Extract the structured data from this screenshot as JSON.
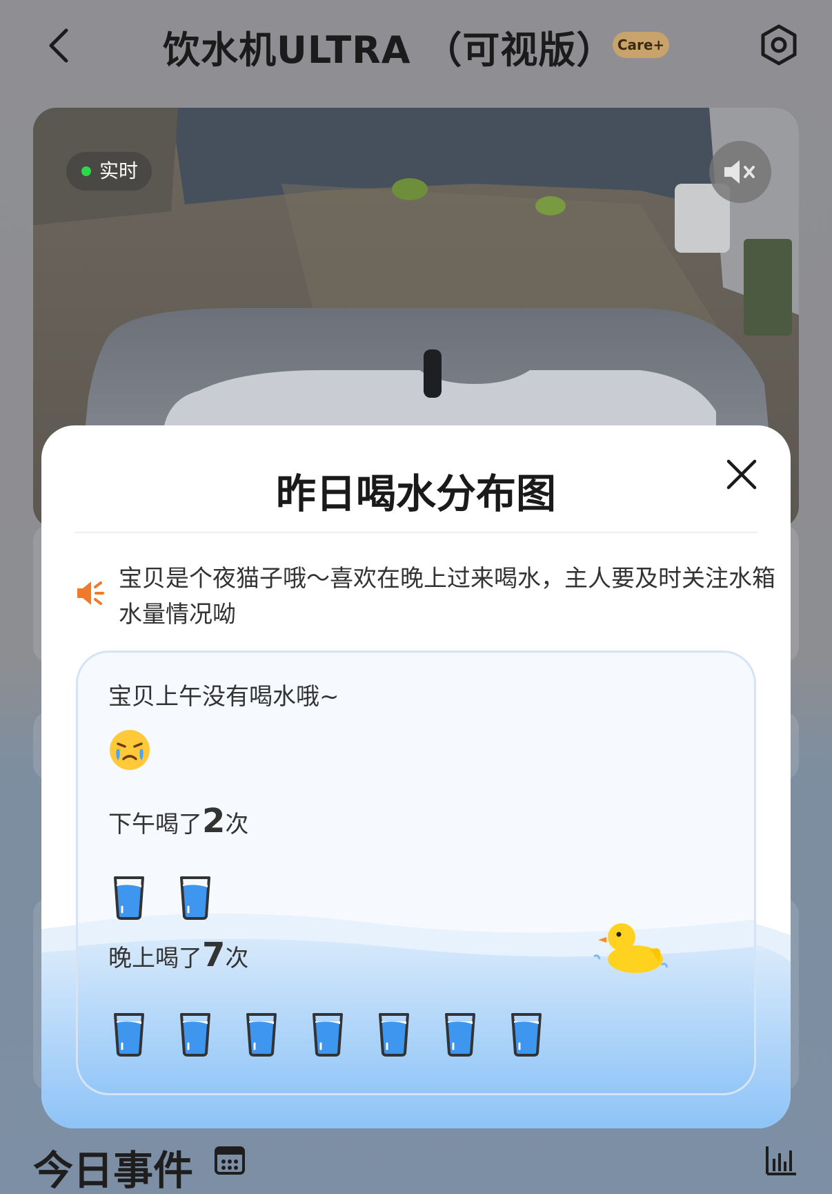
{
  "header": {
    "title": "饮水机ULTRA （可视版）",
    "badge": "Care+",
    "back_icon": "chevron-left-icon",
    "settings_icon": "gear-icon"
  },
  "camera": {
    "live_label": "实时",
    "mute_icon": "speaker-muted-icon"
  },
  "modal": {
    "title": "昨日喝水分布图",
    "close_icon": "close-icon",
    "tip_icon": "speaker-icon",
    "tip": "宝贝是个夜猫子哦～喜欢在晚上过来喝水，主人要及时关注水箱水量情况呦",
    "morning": {
      "label": "宝贝上午没有喝水哦~",
      "icon": "crying-face-icon"
    },
    "afternoon": {
      "prefix": "下午喝了",
      "count": "2",
      "suffix": "次",
      "cups": 2
    },
    "evening": {
      "prefix": "晚上喝了",
      "count": "7",
      "suffix": "次",
      "cups": 7
    },
    "decoration_icon": "rubber-duck-icon"
  },
  "footer": {
    "today_events": "今日事件",
    "calendar_icon": "calendar-icon",
    "stats_icon": "bar-chart-icon"
  },
  "colors": {
    "accent_orange": "#f07a2a",
    "water_blue": "#4a9ff0",
    "badge_gold": "#c8a46c",
    "live_green": "#2fd84a"
  }
}
